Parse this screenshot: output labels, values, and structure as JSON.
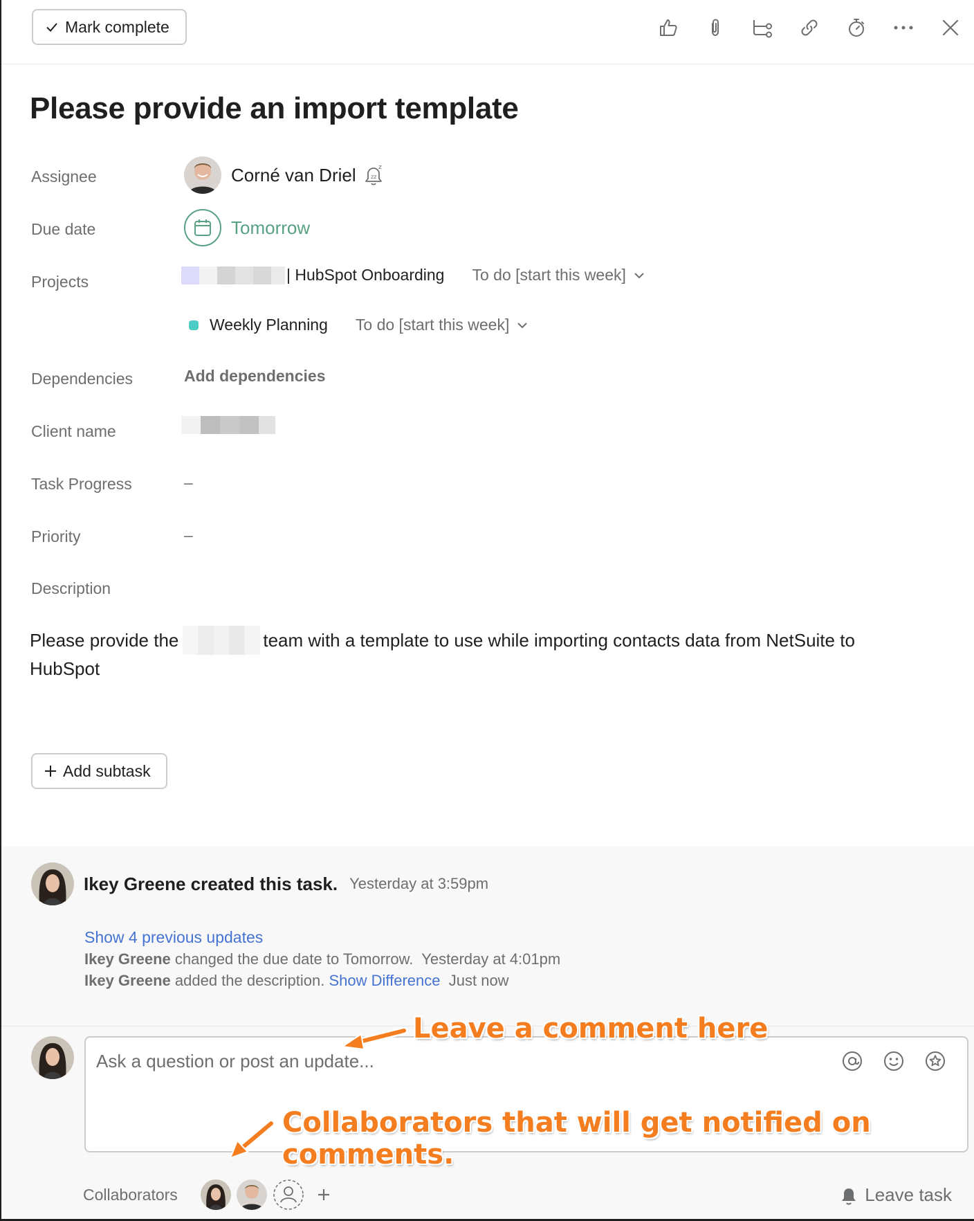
{
  "toolbar": {
    "mark_complete_label": "Mark complete",
    "icons": [
      "thumbs-up-icon",
      "attachment-icon",
      "subtask-icon",
      "link-icon",
      "timer-icon",
      "more-icon",
      "close-icon"
    ]
  },
  "task": {
    "title": "Please provide an import template",
    "fields": {
      "assignee_label": "Assignee",
      "assignee_name": "Corné van Driel",
      "due_label": "Due date",
      "due_value": "Tomorrow",
      "projects_label": "Projects",
      "projects": [
        {
          "name": "| HubSpot Onboarding",
          "section": "To do [start this week]"
        },
        {
          "name": "Weekly Planning",
          "section": "To do [start this week]"
        }
      ],
      "dependencies_label": "Dependencies",
      "dependencies_action": "Add dependencies",
      "client_label": "Client name",
      "progress_label": "Task Progress",
      "progress_value": "–",
      "priority_label": "Priority",
      "priority_value": "–",
      "description_label": "Description"
    },
    "description_part1": "Please provide the",
    "description_part2": "team with a template to use while importing contacts data from NetSuite to HubSpot",
    "add_subtask_label": "Add subtask"
  },
  "activity": {
    "creator_text": "Ikey Greene created this task.",
    "creator_time": "Yesterday at 3:59pm",
    "show_previous": "Show 4 previous updates",
    "updates": [
      {
        "user": "Ikey Greene",
        "text": "changed the due date to Tomorrow.",
        "time": "Yesterday at 4:01pm"
      },
      {
        "user": "Ikey Greene",
        "text": "added the description.",
        "link": "Show Difference",
        "time": "Just now"
      }
    ]
  },
  "comment": {
    "placeholder": "Ask a question or post an update...",
    "collaborators_label": "Collaborators",
    "leave_task_label": "Leave task"
  },
  "annotations": {
    "comment_hint": "Leave a comment here",
    "collaborators_hint": "Collaborators that will get notified on comments."
  },
  "colors": {
    "due_green": "#58a182",
    "link_blue": "#4573d2",
    "annotation_orange": "#f47d20",
    "project_dot": "#4ecbc4"
  }
}
